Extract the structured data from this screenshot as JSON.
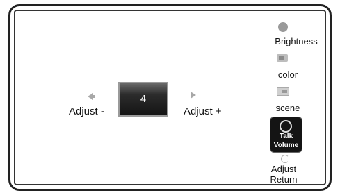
{
  "adjust": {
    "minus_label": "Adjust -",
    "plus_label": "Adjust +",
    "value": "4"
  },
  "menu": {
    "brightness": "Brightness",
    "color": "color",
    "scene": "scene",
    "talk_volume_line1": "Talk",
    "talk_volume_line2": "Volume",
    "adjust_return_line1": "Adjust",
    "adjust_return_line2": "Return"
  },
  "icons": {
    "left": "arrow-left-icon",
    "right": "arrow-right-icon",
    "brightness": "brightness-icon",
    "color": "color-icon",
    "scene": "scene-icon",
    "talk_volume": "volume-knob-icon",
    "return": "return-icon"
  },
  "colors": {
    "selected_bg": "#141414",
    "value_box_bg": "#1f1f1f",
    "icon_gray": "#a8a8a8"
  }
}
